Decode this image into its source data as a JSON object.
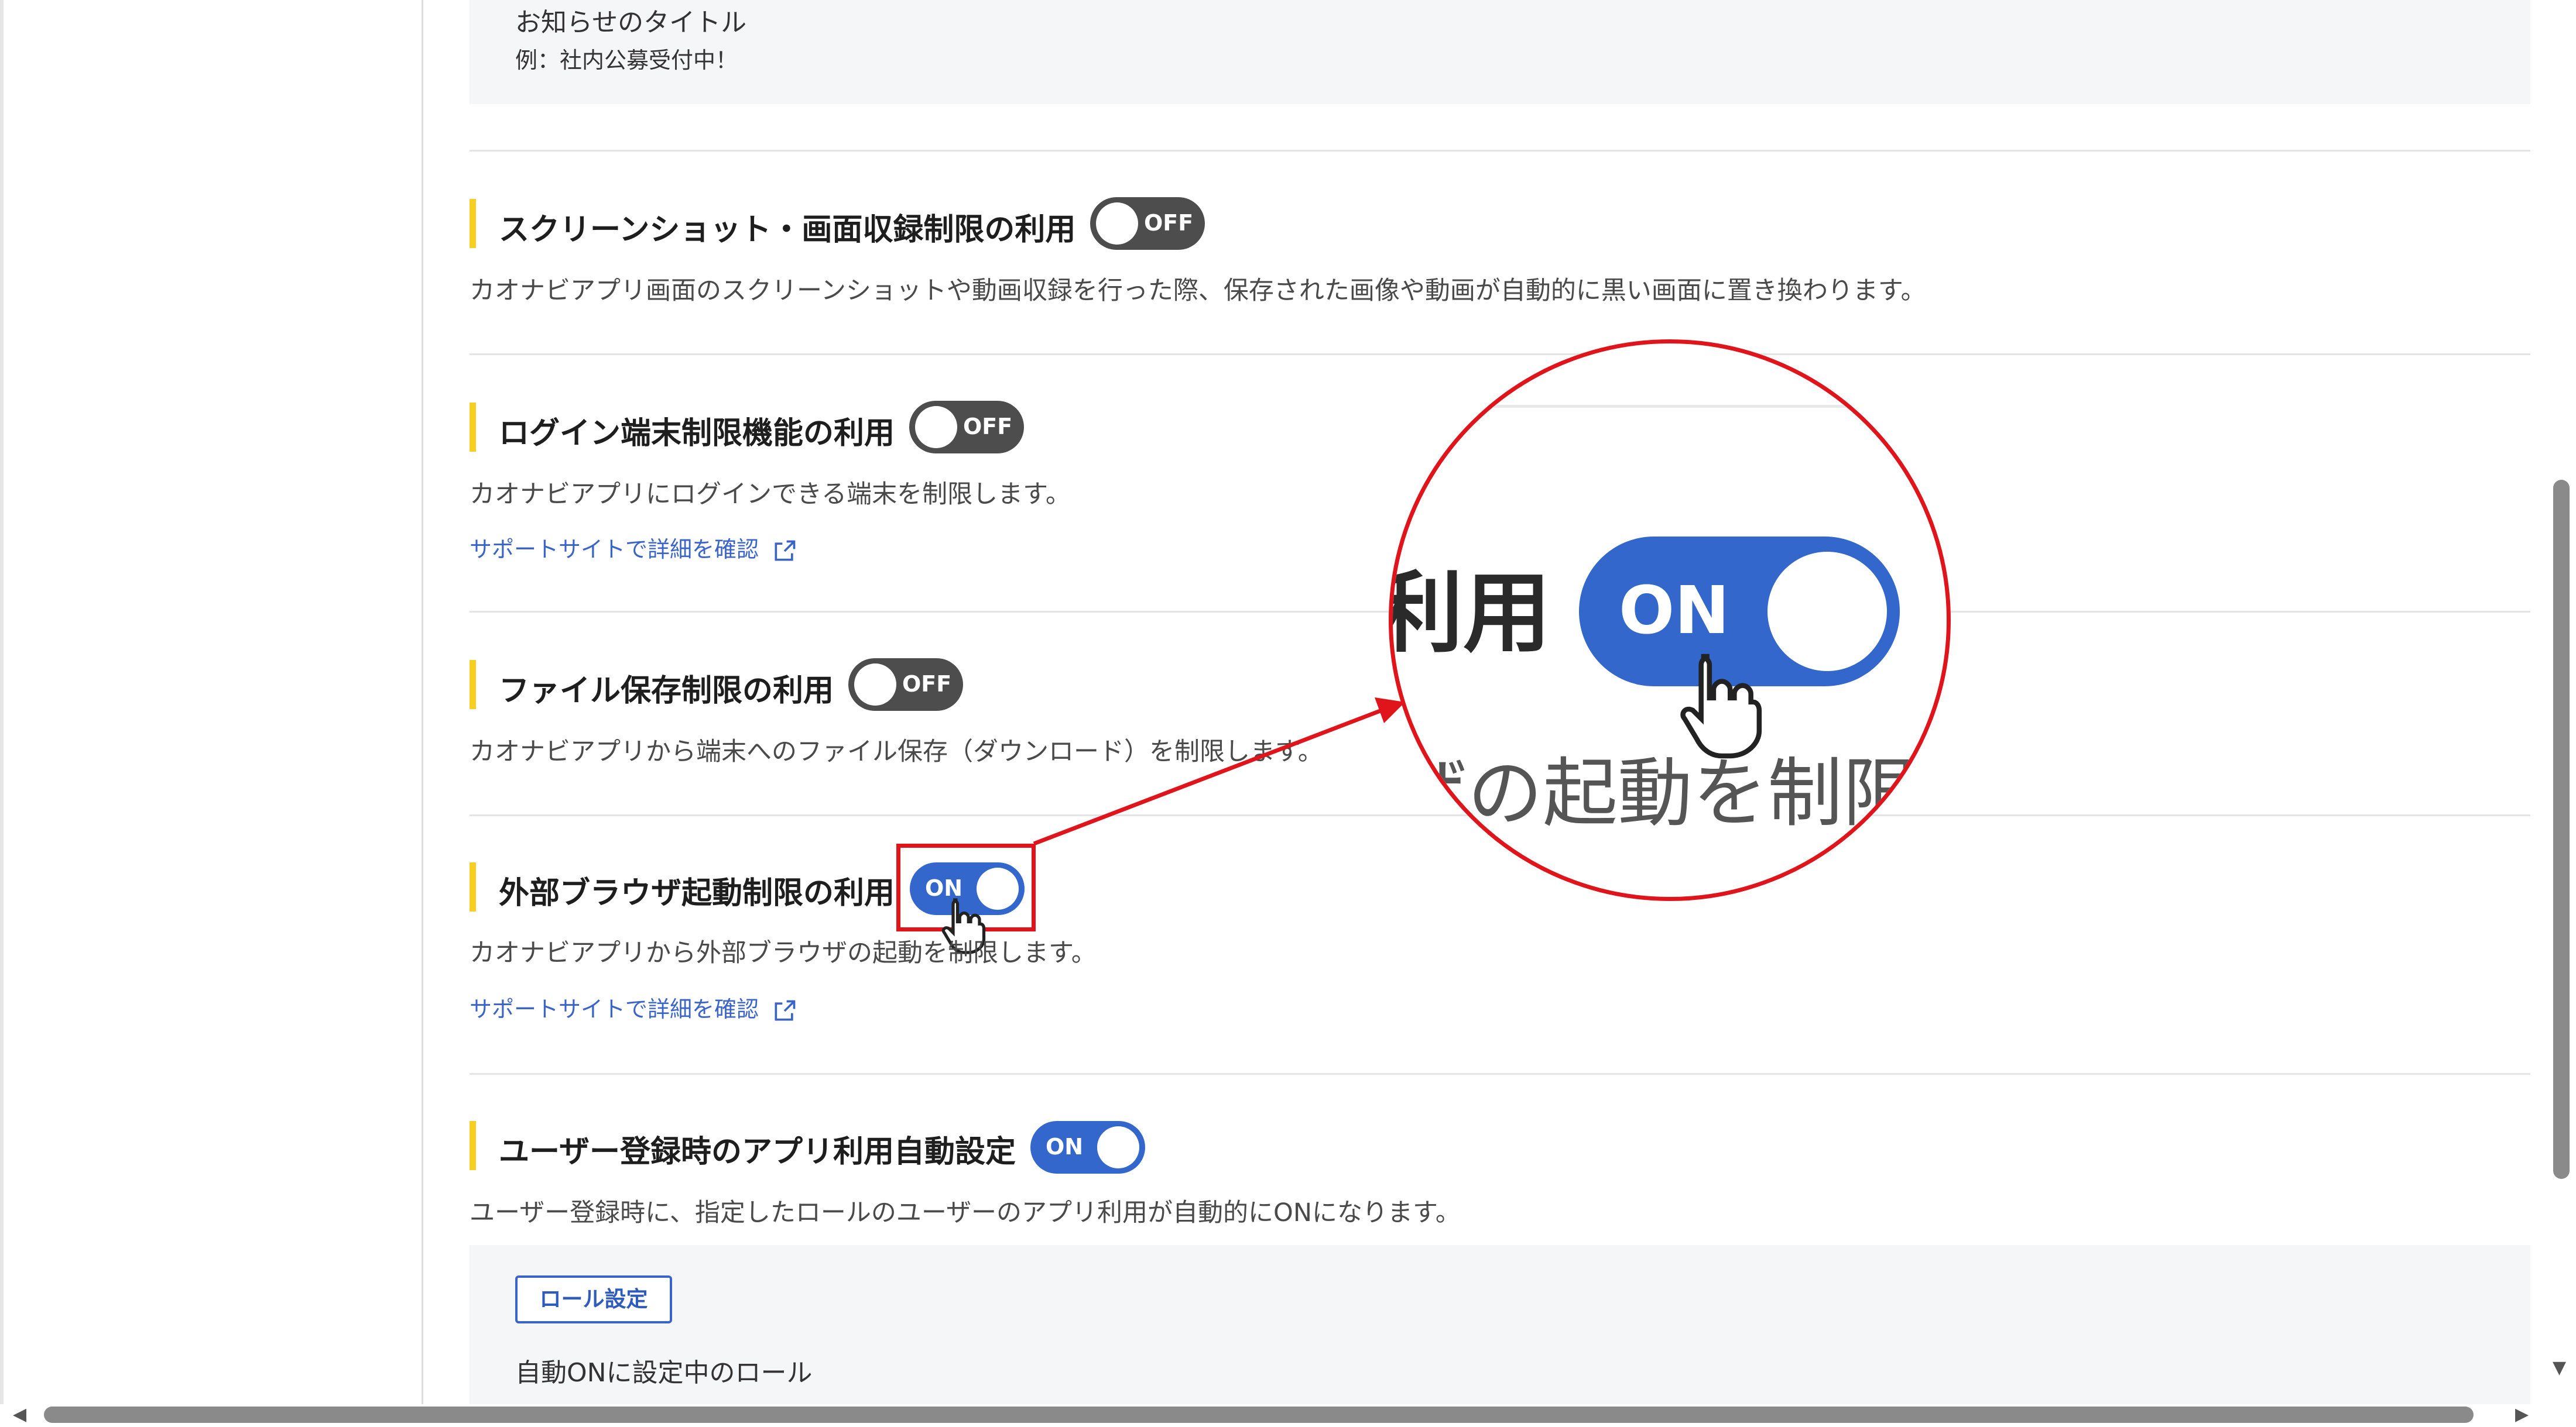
{
  "notice": {
    "title": "お知らせのタイトル",
    "example": "例：社内公募受付中！"
  },
  "settings": [
    {
      "title": "スクリーンショット・画面収録制限の利用",
      "toggle": "OFF",
      "description": "カオナビアプリ画面のスクリーンショットや動画収録を行った際、保存された画像や動画が自動的に黒い画面に置き換わります。"
    },
    {
      "title": "ログイン端末制限機能の利用",
      "toggle": "OFF",
      "description": "カオナビアプリにログインできる端末を制限します。",
      "link": "サポートサイトで詳細を確認"
    },
    {
      "title": "ファイル保存制限の利用",
      "toggle": "OFF",
      "description": "カオナビアプリから端末へのファイル保存（ダウンロード）を制限します。"
    },
    {
      "title": "外部ブラウザ起動制限の利用",
      "toggle": "ON",
      "description": "カオナビアプリから外部ブラウザの起動を制限します。",
      "link": "サポートサイトで詳細を確認"
    },
    {
      "title": "ユーザー登録時のアプリ利用自動設定",
      "toggle": "ON",
      "description": "ユーザー登録時に、指定したロールのユーザーのアプリ利用が自動的にONになります。"
    }
  ],
  "role": {
    "button": "ロール設定",
    "label": "自動ONに設定中のロール"
  },
  "magnifier": {
    "text_top": "利用",
    "toggle": "ON",
    "text_bottom": "ザの起動を制限"
  },
  "colors": {
    "accent": "#3367cc",
    "toggle_off": "#4d4d4d",
    "heading_marker": "#f6cf22",
    "annotation": "#e0141b",
    "link": "#3a64c9"
  },
  "icons": [
    "external-link-icon",
    "pointer-hand-icon",
    "scroll-arrow-left",
    "scroll-arrow-right",
    "scroll-arrow-down"
  ]
}
